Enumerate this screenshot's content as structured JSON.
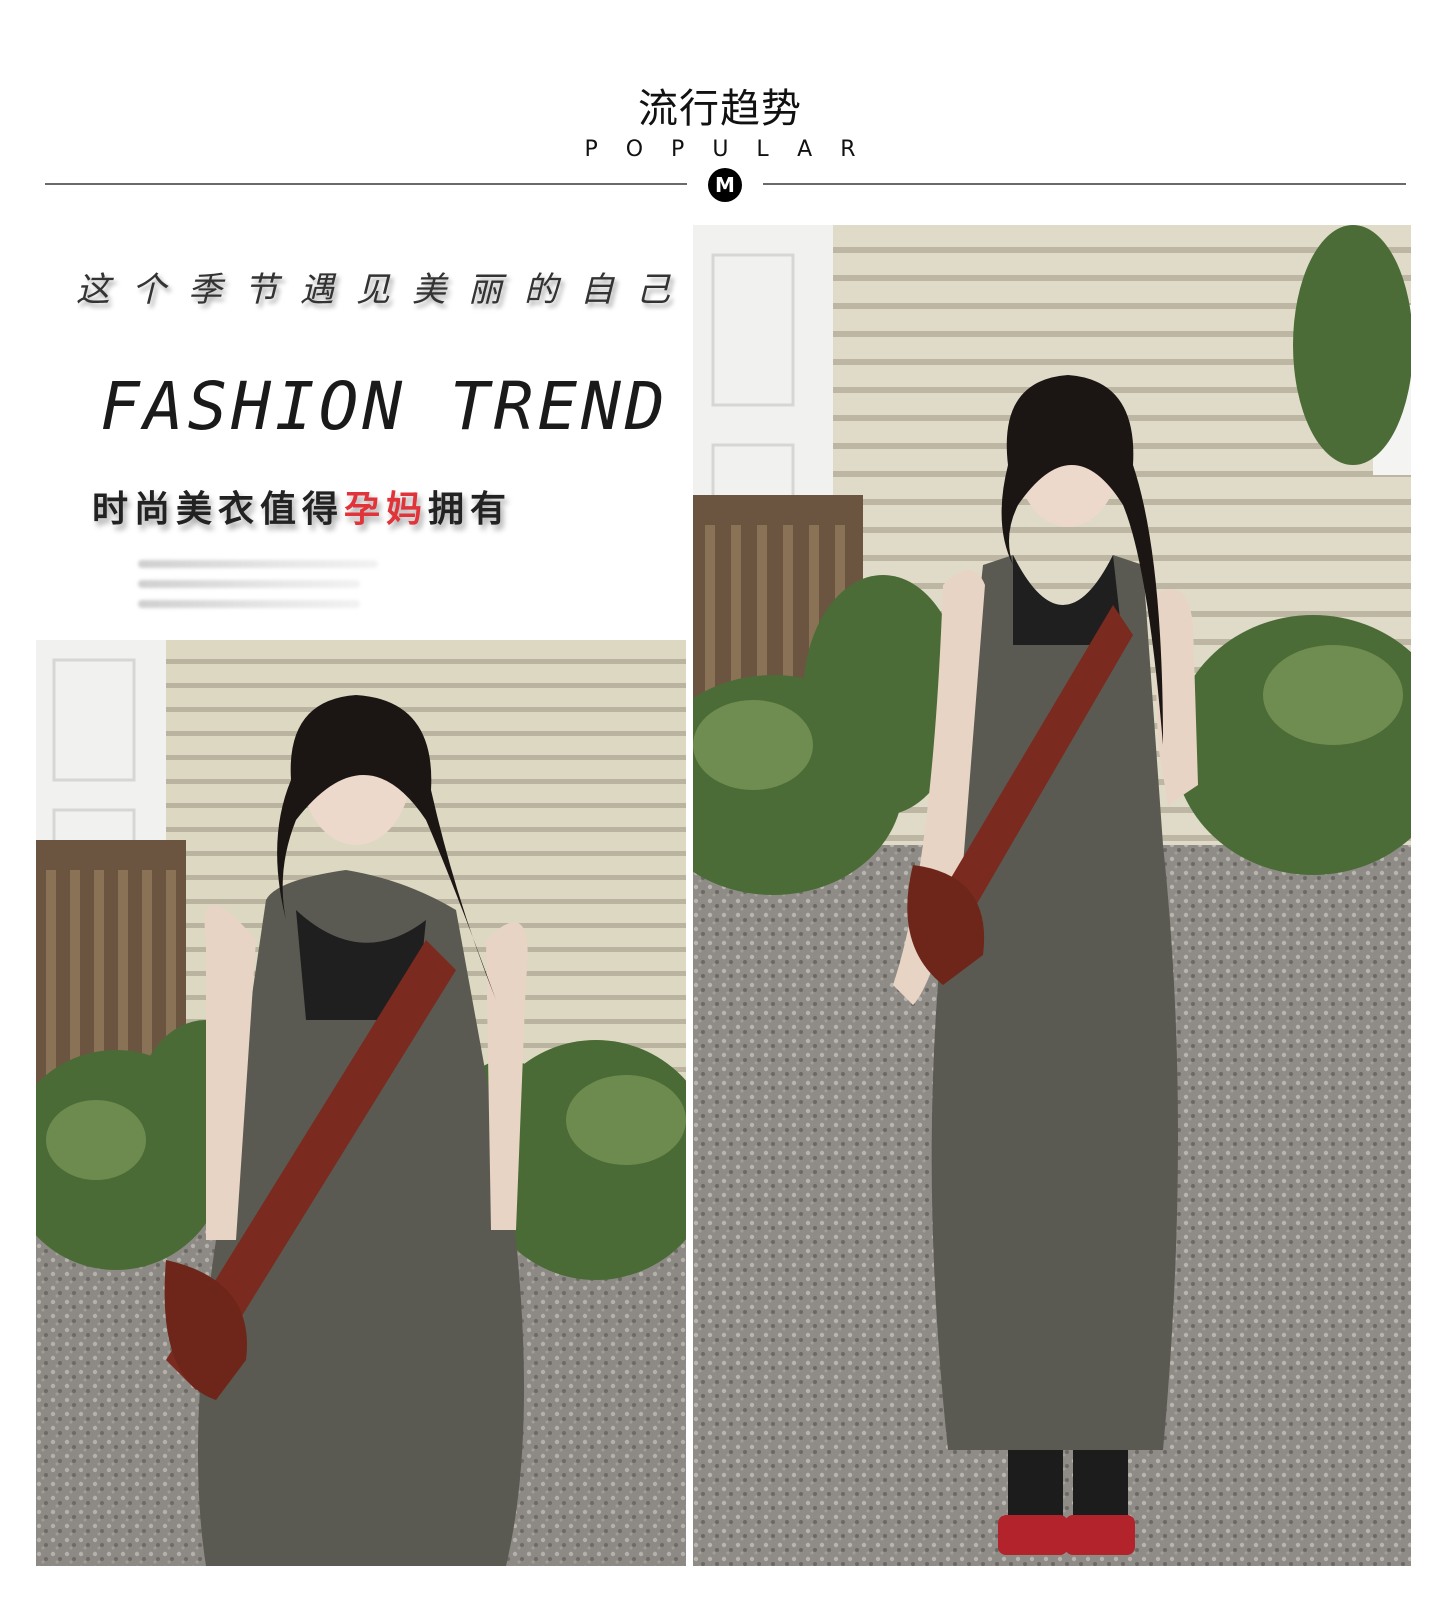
{
  "header": {
    "title": "流行趋势",
    "subtitle": "POPULAR",
    "badge": "M"
  },
  "promo": {
    "slogan": "这个季节遇见美丽的自己!",
    "headline": "FASHION TREND",
    "tagline_before": "时尚美衣值得",
    "tagline_highlight": "孕妈",
    "tagline_after": "拥有"
  },
  "colors": {
    "highlight": "#e0333a",
    "dress": "#5b5a52",
    "bag": "#7a2a1e"
  },
  "photos": [
    {
      "name": "model-photo-looking-up"
    },
    {
      "name": "model-photo-full-length"
    }
  ]
}
